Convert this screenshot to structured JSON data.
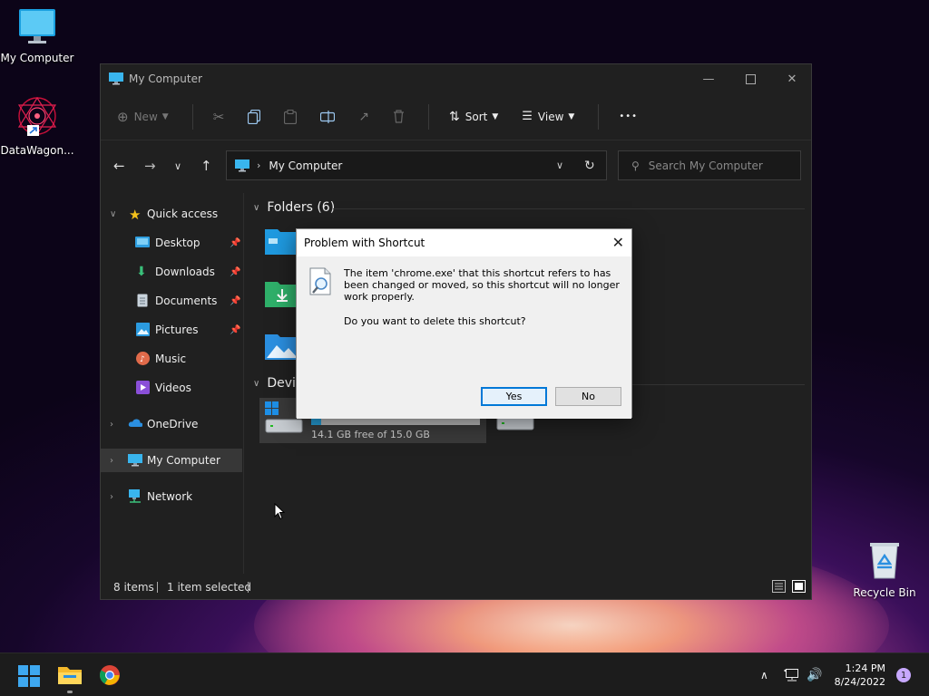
{
  "desktop": {
    "icons": [
      {
        "label": "My Computer"
      },
      {
        "label": "DataWagon..."
      },
      {
        "label": "Recycle Bin"
      }
    ]
  },
  "explorer": {
    "title": "My Computer",
    "toolbar": {
      "new_label": "New",
      "sort_label": "Sort",
      "view_label": "View",
      "more_label": "•••"
    },
    "address": {
      "path": "My Computer",
      "search_placeholder": "Search My Computer"
    },
    "sidebar": {
      "items": [
        {
          "label": "Quick access"
        },
        {
          "label": "Desktop"
        },
        {
          "label": "Downloads"
        },
        {
          "label": "Documents"
        },
        {
          "label": "Pictures"
        },
        {
          "label": "Music"
        },
        {
          "label": "Videos"
        },
        {
          "label": "OneDrive"
        },
        {
          "label": "My Computer"
        },
        {
          "label": "Network"
        }
      ]
    },
    "content": {
      "folders_header": "Folders (6)",
      "devices_header": "Devic",
      "drive_free": "14.1 GB free of 15.0 GB",
      "drive_used_fraction": 0.06
    },
    "status": {
      "items": "8 items",
      "selected": "1 item selected"
    }
  },
  "dialog": {
    "title": "Problem with Shortcut",
    "message": "The item 'chrome.exe' that this shortcut refers to has been changed or moved, so this shortcut will no longer work properly.",
    "question": "Do you want to delete this shortcut?",
    "yes_label": "Yes",
    "no_label": "No"
  },
  "taskbar": {
    "time": "1:24 PM",
    "date": "8/24/2022",
    "notification_count": "1"
  },
  "colors": {
    "accent": "#0078d7",
    "folder": "#ffc83d"
  }
}
